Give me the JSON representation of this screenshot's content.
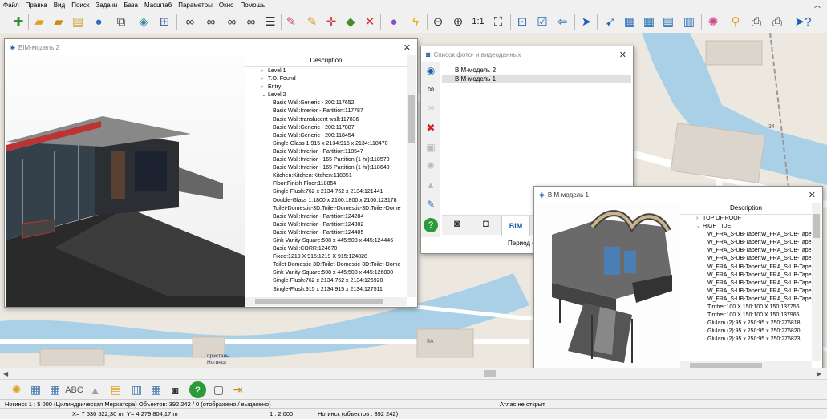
{
  "menu": [
    "Файл",
    "Правка",
    "Вид",
    "Поиск",
    "Задачи",
    "База",
    "Масштаб",
    "Параметры",
    "Окно",
    "Помощь"
  ],
  "colors": {
    "water": "#a9d0e6",
    "road": "#ffffff",
    "land": "#ece8e0",
    "building": "#dcd5cc",
    "titlebar_selected": "#cce4f7"
  },
  "toolbar_icons": [
    "new-document-icon",
    "open-folder-icon",
    "save-icon",
    "database-icon",
    "globe-icon",
    "layers-icon",
    "tree-icon",
    "binoculars-icon",
    "binoculars-a-icon",
    "binoculars-hash-icon",
    "binoculars-list-icon",
    "list-icon",
    "edit-pen-icon",
    "edit-object-icon",
    "move-point-icon",
    "add-point-icon",
    "delete-point-icon",
    "palette-icon",
    "lightning-icon",
    "zoom-out-icon",
    "zoom-in-icon",
    "zoom-fit-icon",
    "frame-icon",
    "window-icon",
    "check-icon",
    "back-icon",
    "pointer-icon",
    "select-icon",
    "layers-select-icon",
    "map-info-icon",
    "table-icon",
    "text-style-icon",
    "color-wheel-icon",
    "location-pin-icon",
    "print-icon",
    "printer2-icon",
    "help-pointer-icon"
  ],
  "toolbar_text": {
    "scale_1_1": "1:1"
  },
  "map_labels": {
    "building_34": "34",
    "building_14": "14",
    "building_8a": "8А",
    "pier_label_1": "пристань",
    "pier_label_2": "Ногинск"
  },
  "bim2": {
    "title": "BIM-модель 2",
    "column": "Description",
    "rows": [
      {
        "text": "Level 1",
        "indent": 1,
        "arrow": ">"
      },
      {
        "text": "T.O. Found",
        "indent": 1,
        "arrow": ">"
      },
      {
        "text": "Entry",
        "indent": 1,
        "arrow": ">"
      },
      {
        "text": "Level 2",
        "indent": 1,
        "arrow": "v"
      },
      {
        "text": "Basic Wall:Generic - 200:117652",
        "indent": 2,
        "arrow": ""
      },
      {
        "text": "Basic Wall:Interior - Partition:117787",
        "indent": 2,
        "arrow": ""
      },
      {
        "text": "Basic Wall:translucent wall:117836",
        "indent": 2,
        "arrow": ""
      },
      {
        "text": "Basic Wall:Generic - 200:117887",
        "indent": 2,
        "arrow": ""
      },
      {
        "text": "Basic Wall:Generic - 200:118454",
        "indent": 2,
        "arrow": ""
      },
      {
        "text": "Single-Glass 1:915 x 2134:915 x 2134:118470",
        "indent": 2,
        "arrow": ""
      },
      {
        "text": "Basic Wall:Interior - Partition:118547",
        "indent": 2,
        "arrow": ""
      },
      {
        "text": "Basic Wall:Interior - 165 Partition (1-hr):118570",
        "indent": 2,
        "arrow": ""
      },
      {
        "text": "Basic Wall:Interior - 165 Partition (1-hr):118640",
        "indent": 2,
        "arrow": ""
      },
      {
        "text": "Kitchen:Kitchen:Kitchen:118851",
        "indent": 2,
        "arrow": ""
      },
      {
        "text": "Floor:Finish Floor:118854",
        "indent": 2,
        "arrow": ""
      },
      {
        "text": "Single-Flush:762 x 2134:762 x 2134:121441",
        "indent": 2,
        "arrow": ""
      },
      {
        "text": "Double-Glass 1:1800 x 2100:1800 x 2100:123178",
        "indent": 2,
        "arrow": ""
      },
      {
        "text": "Toilet-Domestic-3D:Toilet-Domestic-3D:Toilet-Dome",
        "indent": 2,
        "arrow": ""
      },
      {
        "text": "Basic Wall:Interior - Partition:124284",
        "indent": 2,
        "arrow": ""
      },
      {
        "text": "Basic Wall:Interior - Partition:124302",
        "indent": 2,
        "arrow": ""
      },
      {
        "text": "Basic Wall:Interior - Partition:124405",
        "indent": 2,
        "arrow": ""
      },
      {
        "text": "Sink Vanity-Square:508 x 445:508 x 445:124446",
        "indent": 2,
        "arrow": ""
      },
      {
        "text": "Basic Wall:CORR:124670",
        "indent": 2,
        "arrow": ""
      },
      {
        "text": "Fixed:1219 X 915:1219 X 915:124828",
        "indent": 2,
        "arrow": ""
      },
      {
        "text": "Toilet-Domestic-3D:Toilet-Domestic-3D:Toilet-Dome",
        "indent": 2,
        "arrow": ""
      },
      {
        "text": "Sink Vanity-Square:508 x 445:508 x 445:126800",
        "indent": 2,
        "arrow": ""
      },
      {
        "text": "Single-Flush:762 x 2134:762 x 2134:126920",
        "indent": 2,
        "arrow": ""
      },
      {
        "text": "Single-Flush:915 x 2134:915 x 2134:127511",
        "indent": 2,
        "arrow": ""
      }
    ]
  },
  "photos": {
    "title": "Список фото- и видеоданных",
    "items": [
      "BIM-модель 2",
      "BIM-модель 1"
    ],
    "selected_index": 1,
    "footer_text": "Период с",
    "side_icons": [
      "view-icon",
      "binoculars-icon",
      "binoculars-disabled-icon",
      "delete-icon",
      "save-icon",
      "settings-disabled-icon",
      "stamp-icon",
      "edit-icon",
      "help-icon"
    ],
    "tabs": [
      "camera-icon",
      "photo-icon",
      "bim-icon"
    ]
  },
  "bim1": {
    "title": "BIM-модель 1",
    "column": "Description",
    "rows": [
      {
        "text": "TOP OF ROOF",
        "indent": 1,
        "arrow": ">"
      },
      {
        "text": "HIGH TIDE",
        "indent": 1,
        "arrow": "v"
      },
      {
        "text": "W_FRA_S-UB-Taper:W_FRA_S-UB-Taper:",
        "indent": 2,
        "arrow": ""
      },
      {
        "text": "W_FRA_S-UB-Taper:W_FRA_S-UB-Taper:",
        "indent": 2,
        "arrow": ""
      },
      {
        "text": "W_FRA_S-UB-Taper:W_FRA_S-UB-Taper:",
        "indent": 2,
        "arrow": ""
      },
      {
        "text": "W_FRA_S-UB-Taper:W_FRA_S-UB-Taper:",
        "indent": 2,
        "arrow": ""
      },
      {
        "text": "W_FRA_S-UB-Taper:W_FRA_S-UB-Taper:",
        "indent": 2,
        "arrow": ""
      },
      {
        "text": "W_FRA_S-UB-Taper:W_FRA_S-UB-Taper:",
        "indent": 2,
        "arrow": ""
      },
      {
        "text": "W_FRA_S-UB-Taper:W_FRA_S-UB-Taper:",
        "indent": 2,
        "arrow": ""
      },
      {
        "text": "W_FRA_S-UB-Taper:W_FRA_S-UB-Taper:",
        "indent": 2,
        "arrow": ""
      },
      {
        "text": "W_FRA_S-UB-Taper:W_FRA_S-UB-Taper:",
        "indent": 2,
        "arrow": ""
      },
      {
        "text": "Timber:100 X 150:100 X 150:137756",
        "indent": 2,
        "arrow": ""
      },
      {
        "text": "Timber:100 X 150:100 X 150:137965",
        "indent": 2,
        "arrow": ""
      },
      {
        "text": "Glulam (2):95 x 250:95 x 250:276818",
        "indent": 2,
        "arrow": ""
      },
      {
        "text": "Glulam (2):95 x 250:95 x 250:276820",
        "indent": 2,
        "arrow": ""
      },
      {
        "text": "Glulam (2):95 x 250:95 x 250:276823",
        "indent": 2,
        "arrow": ""
      }
    ]
  },
  "bottom_icons": [
    "settings-icon",
    "layers-icon",
    "layers2-icon",
    "letters-icon",
    "triangle-icon",
    "layers3-icon",
    "book-icon",
    "map-stack-icon",
    "camera-icon",
    "help-icon",
    "panel-icon",
    "exit-icon"
  ],
  "status": {
    "line1_left": "Ногинск   1 : 5 000 (Цилиндрическая Меркатора) Объектов: 392 242 / 0 (отображено / выделено)",
    "line1_right": "Атлас не открыт",
    "x": "X= 7 530 522,30 m",
    "y": "Y= 4 279 804,17 m",
    "scale": "1 : 2 000",
    "region": "Ногинск   (объектов : 392 242)"
  }
}
